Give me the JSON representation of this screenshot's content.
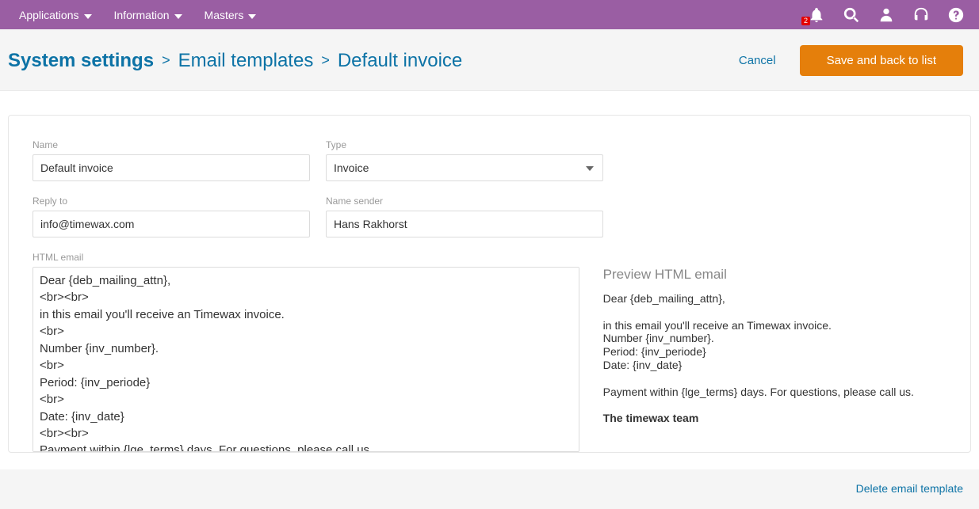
{
  "topbar": {
    "menus": [
      "Applications",
      "Information",
      "Masters"
    ],
    "notification_count": "2"
  },
  "breadcrumbs": {
    "root": "System settings",
    "sep": ">",
    "middle": "Email templates",
    "current": "Default invoice"
  },
  "actions": {
    "cancel_label": "Cancel",
    "save_label": "Save and back to list"
  },
  "form": {
    "name_label": "Name",
    "name_value": "Default invoice",
    "type_label": "Type",
    "type_value": "Invoice",
    "replyto_label": "Reply to",
    "replyto_value": "info@timewax.com",
    "sender_label": "Name sender",
    "sender_value": "Hans Rakhorst",
    "html_label": "HTML email",
    "html_value": "Dear {deb_mailing_attn},\n<br><br>\nin this email you'll receive an Timewax invoice.\n<br>\nNumber {inv_number}.\n<br>\nPeriod: {inv_periode}\n<br>\nDate: {inv_date}\n<br><br>\nPayment within {lge_terms} days. For questions, please call us.\n<br><br>\n<b>The timewax team</b>"
  },
  "preview": {
    "title": "Preview HTML email",
    "html": "Dear {deb_mailing_attn},<br><br>in this email you'll receive an Timewax invoice.<br>Number {inv_number}.<br>Period: {inv_periode}<br>Date: {inv_date}<br><br>Payment within {lge_terms} days. For questions, please call us.<br><br><b>The timewax team</b>"
  },
  "footer": {
    "delete_label": "Delete email template"
  }
}
